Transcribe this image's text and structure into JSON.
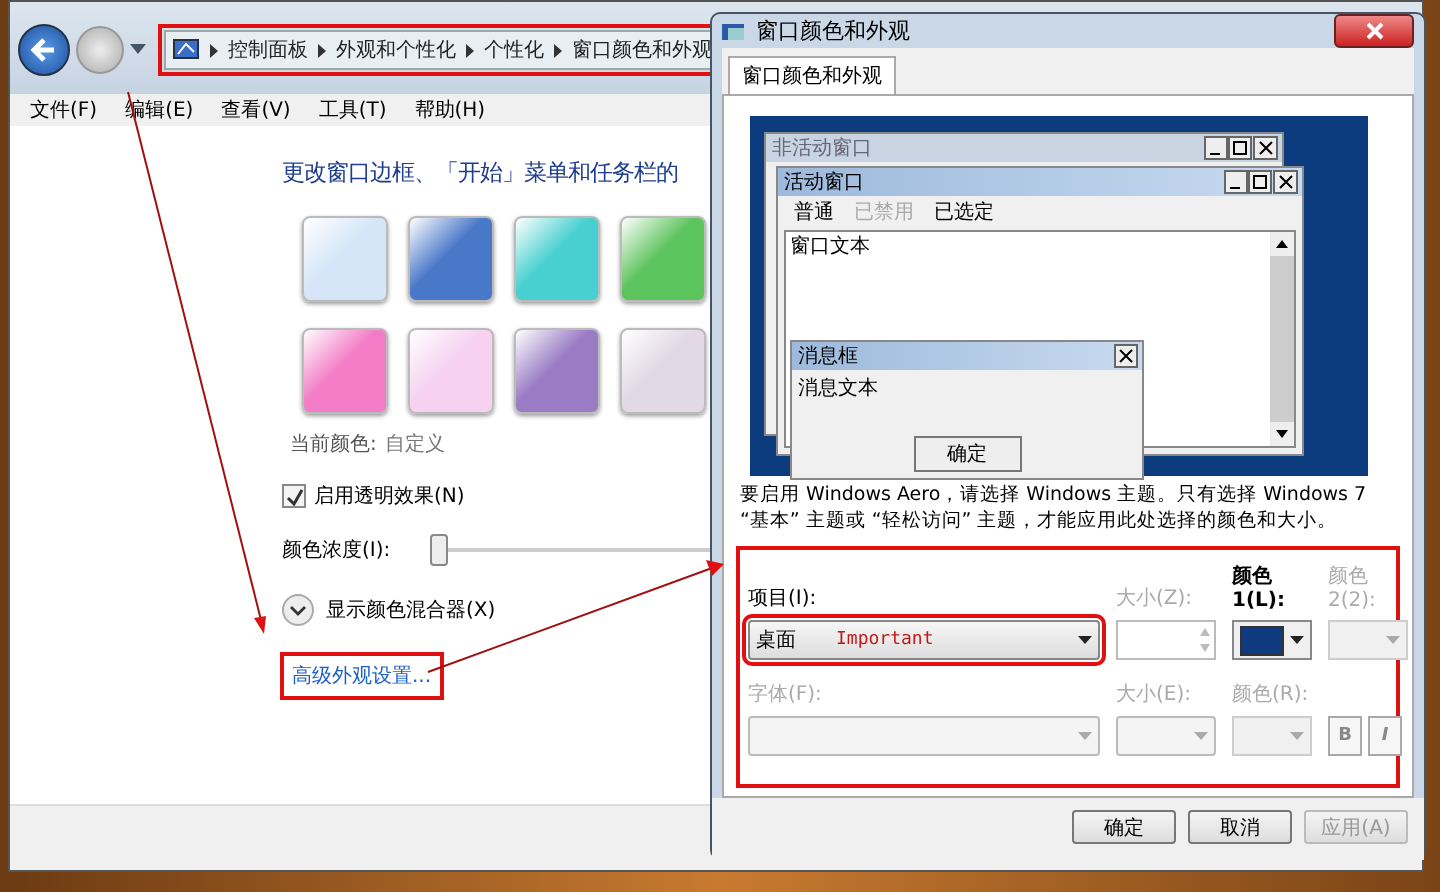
{
  "explorer": {
    "breadcrumb": [
      "控制面板",
      "外观和个性化",
      "个性化",
      "窗口颜色和外观"
    ],
    "menu": [
      "文件(F)",
      "编辑(E)",
      "查看(V)",
      "工具(T)",
      "帮助(H)"
    ],
    "heading": "更改窗口边框、「开始」菜单和任务栏的",
    "swatches": [
      {
        "color": "#d6e6f8"
      },
      {
        "color": "#4a78c8"
      },
      {
        "color": "#48d0d0"
      },
      {
        "color": "#5cc45c"
      },
      {
        "color": "#f27cc6"
      },
      {
        "color": "#f6d2f0"
      },
      {
        "color": "#9a7cc4"
      },
      {
        "color": "#e2d8e6"
      }
    ],
    "current_color_label": "当前颜色:",
    "current_color_value": "自定义",
    "transparency": {
      "label": "启用透明效果(N)",
      "checked": true
    },
    "intensity": {
      "label": "颜色浓度(I):",
      "level": 0.0
    },
    "mixer": {
      "label": "显示颜色混合器(X)"
    },
    "advanced_link": "高级外观设置..."
  },
  "dialog": {
    "title": "窗口颜色和外观",
    "tabs": [
      {
        "label": "窗口颜色和外观",
        "selected": true
      }
    ],
    "preview": {
      "inactive_title": "非活动窗口",
      "active_title": "活动窗口",
      "menu": [
        {
          "label": "普通",
          "kind": "normal"
        },
        {
          "label": "已禁用",
          "kind": "disabled"
        },
        {
          "label": "已选定",
          "kind": "selected"
        }
      ],
      "window_text": "窗口文本",
      "message_title": "消息框",
      "message_text": "消息文本",
      "ok": "确定"
    },
    "note": "要启用 Windows Aero，请选择 Windows 主题。只有选择 Windows 7 “基本” 主题或 “轻松访问” 主题，才能应用此处选择的颜色和大小。",
    "item": {
      "label": "项目(I):",
      "value": "桌面",
      "annotation": "Important"
    },
    "size": {
      "label": "大小(Z):",
      "disabled": true
    },
    "color1": {
      "label": "颜色 1(L):",
      "color": "#0f3a80",
      "disabled": false
    },
    "color2": {
      "label": "颜色 2(2):",
      "disabled": true
    },
    "font": {
      "label": "字体(F):",
      "disabled": true
    },
    "font_size": {
      "label": "大小(E):",
      "disabled": true
    },
    "font_color": {
      "label": "颜色(R):",
      "disabled": true
    },
    "bold": "B",
    "italic": "I",
    "buttons": [
      {
        "label": "确定",
        "disabled": false
      },
      {
        "label": "取消",
        "disabled": false
      },
      {
        "label": "应用(A)",
        "disabled": true
      }
    ]
  }
}
